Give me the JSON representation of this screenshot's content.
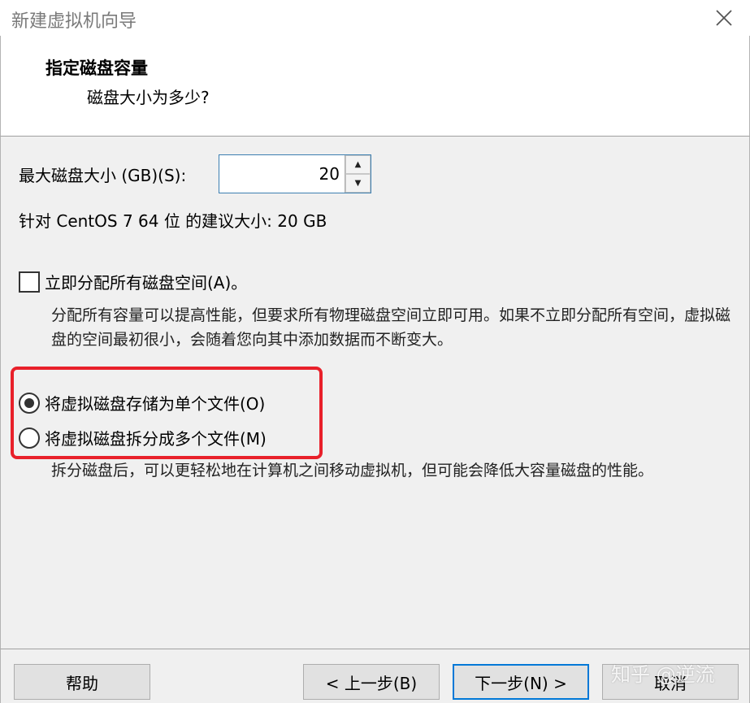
{
  "window": {
    "title": "新建虚拟机向导"
  },
  "header": {
    "title": "指定磁盘容量",
    "subtitle": "磁盘大小为多少?"
  },
  "disk_size": {
    "label": "最大磁盘大小 (GB)(S):",
    "value": "20",
    "up_glyph": "▲",
    "down_glyph": "▼"
  },
  "recommended": {
    "text": "针对 CentOS 7 64 位 的建议大小: 20 GB"
  },
  "allocate": {
    "label": "立即分配所有磁盘空间(A)。",
    "checked": false,
    "description": "分配所有容量可以提高性能，但要求所有物理磁盘空间立即可用。如果不立即分配所有空间，虚拟磁盘的空间最初很小，会随着您向其中添加数据而不断变大。"
  },
  "storage_options": [
    {
      "label": "将虚拟磁盘存储为单个文件(O)",
      "checked": true
    },
    {
      "label": "将虚拟磁盘拆分成多个文件(M)",
      "checked": false
    }
  ],
  "split_description": "拆分磁盘后，可以更轻松地在计算机之间移动虚拟机，但可能会降低大容量磁盘的性能。",
  "footer": {
    "help": "帮助",
    "prev": "< 上一步(B)",
    "next": "下一步(N) >",
    "cancel": "取消"
  },
  "watermark": "知乎 @逆流",
  "colors": {
    "highlight": "#e8202a",
    "default_button_border": "#0078d7"
  },
  "icons": {
    "close": "close-icon"
  }
}
